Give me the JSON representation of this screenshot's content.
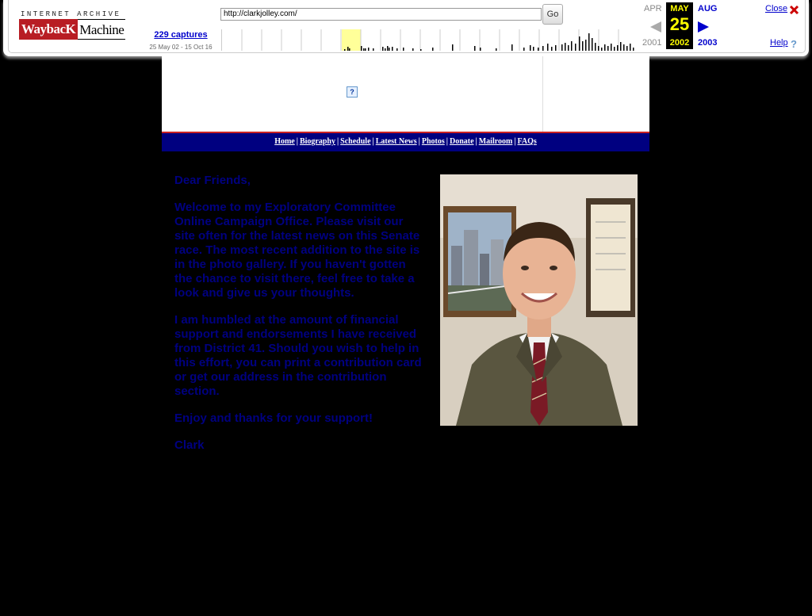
{
  "wayback": {
    "logo_top": "INTERNET ARCHIVE",
    "logo_way": "WaybacK",
    "logo_machine": "Machine",
    "captures_label": "229 captures",
    "capture_range": "25 May 02 - 15 Oct 16",
    "url_value": "http://clarkjolley.com/",
    "go_label": "Go",
    "prev_month": "APR",
    "current_month": "MAY",
    "next_month": "AUG",
    "current_day": "25",
    "prev_year": "2001",
    "current_year": "2002",
    "next_year": "2003",
    "close_label": "Close",
    "help_label": "Help",
    "icons": {
      "prev": "left-arrow-icon",
      "next": "right-arrow-icon",
      "close": "close-x-icon",
      "help": "help-question-icon"
    },
    "colors": {
      "link": "#0000cc",
      "current_highlight": "#ffff00",
      "close_x": "#cc0000"
    }
  },
  "site": {
    "banner_placeholder_glyph": "?",
    "nav": [
      {
        "label": "Home"
      },
      {
        "label": "Biography"
      },
      {
        "label": "Schedule"
      },
      {
        "label": "Latest News"
      },
      {
        "label": "Photos"
      },
      {
        "label": "Donate"
      },
      {
        "label": "Mailroom"
      },
      {
        "label": "FAQs"
      }
    ],
    "nav_separator": "|",
    "letter": {
      "greeting": "Dear Friends,",
      "paragraph1": "Welcome to my Exploratory Committee Online Campaign Office. Please visit our site often for the latest news on this Senate race. The most recent addition to the site is in the photo gallery. If you haven't gotten the chance to visit there, feel free to take a look and give us your thoughts.",
      "paragraph2": "I am humbled at the amount of financial support and endorsements I have received from District 41. Should you wish to help in this effort, you can print a contribution card or get our address in the contribution section.",
      "closing": "Enjoy and thanks for your support!",
      "signature": "Clark"
    },
    "colors": {
      "navbar_bg": "#000080",
      "text": "#000080",
      "accent_line": "#cc2222"
    }
  }
}
